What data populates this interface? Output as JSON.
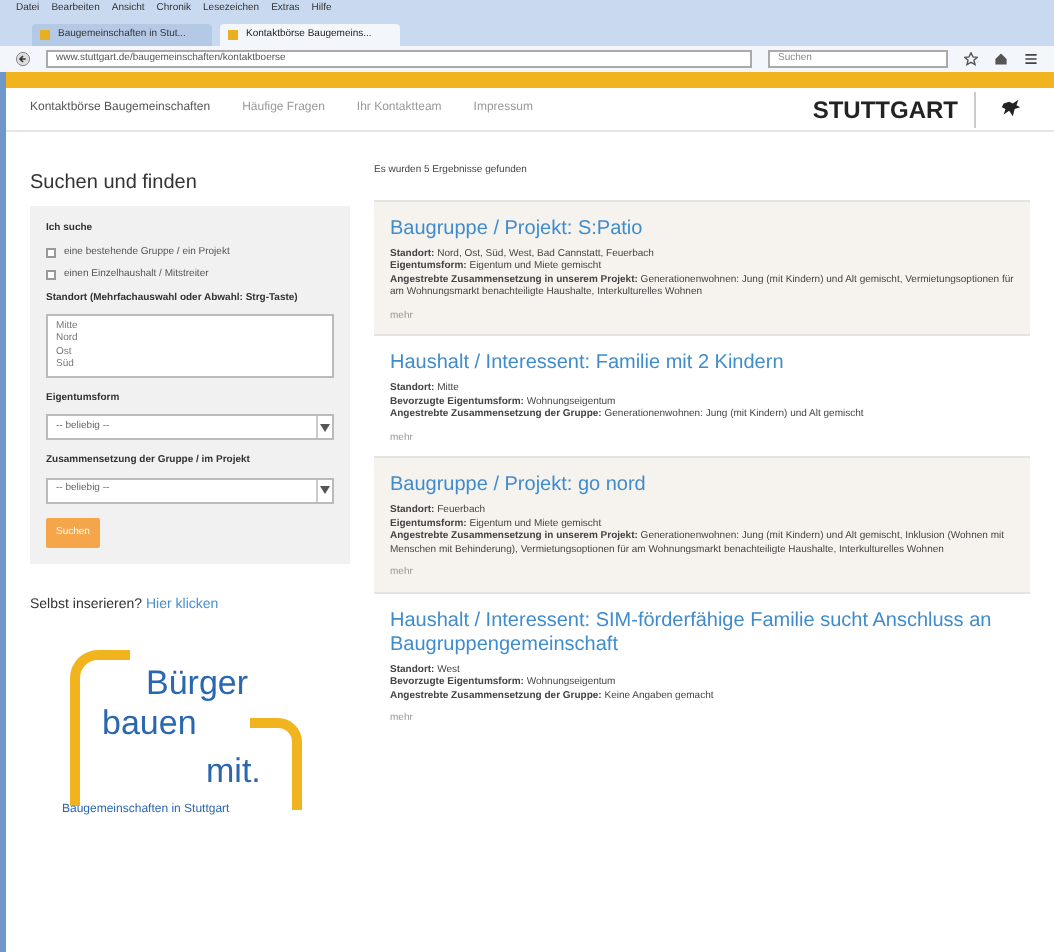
{
  "browser": {
    "menu": [
      "Datei",
      "Bearbeiten",
      "Ansicht",
      "Chronik",
      "Lesezeichen",
      "Extras",
      "Hilfe"
    ],
    "tabs": [
      {
        "label": "Baugemeinschaften in Stut...",
        "selected": false
      },
      {
        "label": "Kontaktbörse Baugemeins...",
        "selected": true
      }
    ],
    "url": "www.stuttgart.de/baugemeinschaften/kontaktboerse",
    "search": {
      "placeholder": "Suchen"
    }
  },
  "nav": {
    "items": [
      "Kontaktbörse Baugemeinschaften",
      "Häufige Fragen",
      "Ihr Kontaktteam",
      "Impressum"
    ],
    "logo": "STUTTGART"
  },
  "sidebar": {
    "title": "Suchen und finden",
    "filter_heading": "Ich suche",
    "checkboxes": [
      {
        "label": "eine bestehende Gruppe / ein Projekt",
        "checked": false
      },
      {
        "label": "einen Einzelhaushalt / Mitstreiter",
        "checked": false
      }
    ],
    "location_label": "Standort (Mehrfachauswahl oder Abwahl: Strg-Taste)",
    "locations": [
      "Mitte",
      "Nord",
      "Ost",
      "Süd"
    ],
    "ownership_label": "Eigentumsform",
    "ownership_value": "-- beliebig --",
    "composition_label": "Zusammensetzung der Gruppe / im Projekt",
    "composition_value": "-- beliebig --",
    "submit": "Suchen",
    "insert_text": "Selbst inserieren?",
    "insert_link": "Hier klicken",
    "logo": {
      "line1": "Bürger",
      "line2": "bauen",
      "line3": "mit.",
      "tagline": "Baugemeinschaften in Stuttgart"
    }
  },
  "results": {
    "count_text": "Es wurden 5 Ergebnisse gefunden",
    "items": [
      {
        "kind": "group",
        "title": "Baugruppe / Projekt: S:Patio",
        "fields": [
          "**Standort:** Nord, Ost, Süd, West, Bad Cannstatt, Feuerbach",
          "**Eigentumsform:** Eigentum und Miete gemischt",
          "**Angestrebte Zusammensetzung in unserem Projekt:** Generationenwohnen: Jung (mit Kindern) und Alt gemischt, Vermietungsoptionen für am Wohnungsmarkt benachteiligte Haushalte, Interkulturelles Wohnen"
        ],
        "more": "mehr"
      },
      {
        "kind": "household",
        "title": "Haushalt / Interessent: Familie mit 2 Kindern",
        "fields": [
          "**Standort:** Mitte",
          "**Bevorzugte Eigentumsform:** Wohnungseigentum",
          "**Angestrebte Zusammensetzung der Gruppe:** Generationenwohnen: Jung (mit Kindern) und Alt gemischt"
        ],
        "more": "mehr"
      },
      {
        "kind": "group",
        "title": "Baugruppe / Projekt: go nord",
        "fields": [
          "**Standort:** Feuerbach",
          "**Eigentumsform:** Eigentum und Miete gemischt",
          "**Angestrebte Zusammensetzung in unserem Projekt:** Generationenwohnen: Jung (mit Kindern) und Alt gemischt, Inklusion (Wohnen mit Menschen mit Behinderung), Vermietungsoptionen für am Wohnungsmarkt benachteiligte Haushalte, Interkulturelles Wohnen"
        ],
        "more": "mehr"
      },
      {
        "kind": "household",
        "title": "Haushalt / Interessent: SIM-förderfähige Familie sucht Anschluss an Baugruppengemeinschaft",
        "fields": [
          "**Standort:** West",
          "**Bevorzugte Eigentumsform:** Wohnungseigentum",
          "**Angestrebte Zusammensetzung der Gruppe:** Keine Angaben gemacht"
        ],
        "more": "mehr"
      }
    ]
  }
}
